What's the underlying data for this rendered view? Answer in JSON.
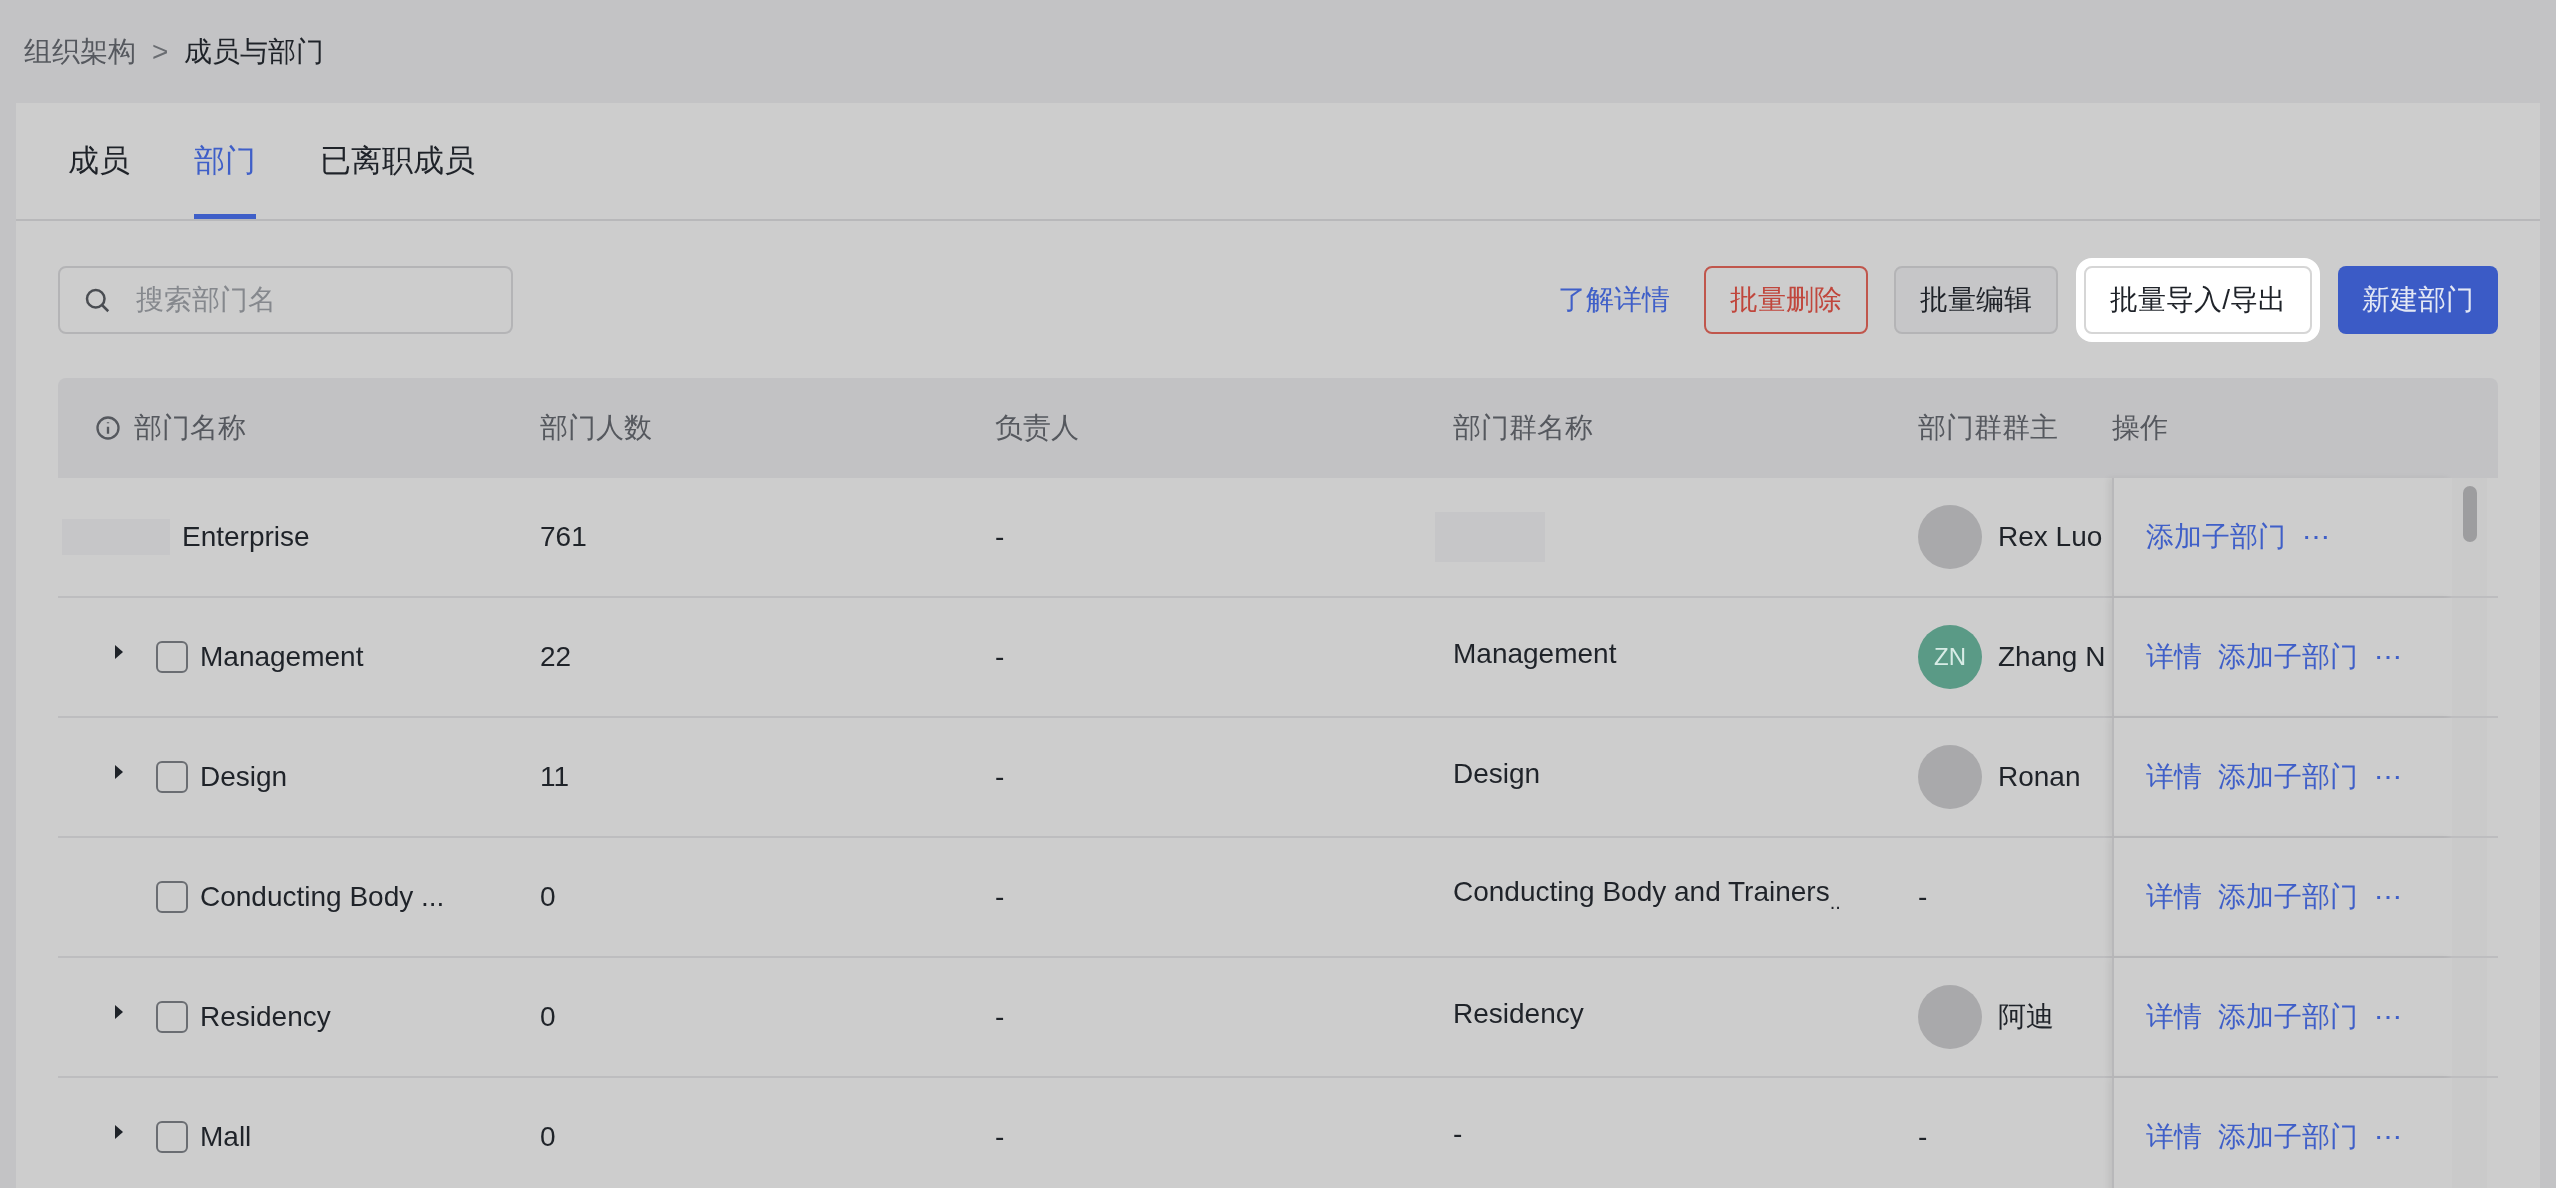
{
  "breadcrumb": {
    "parent": "组织架构",
    "separator": ">",
    "current": "成员与部门"
  },
  "tabs": [
    {
      "label": "成员",
      "selected": false
    },
    {
      "label": "部门",
      "selected": true
    },
    {
      "label": "已离职成员",
      "selected": false
    }
  ],
  "search": {
    "placeholder": "搜索部门名"
  },
  "actions": [
    {
      "kind": "link",
      "label": "了解详情"
    },
    {
      "kind": "danger",
      "label": "批量删除"
    },
    {
      "kind": "default",
      "label": "批量编辑"
    },
    {
      "kind": "highlighted",
      "label": "批量导入/导出"
    },
    {
      "kind": "primary",
      "label": "新建部门"
    }
  ],
  "table": {
    "columns": [
      "部门名称",
      "部门人数",
      "负责人",
      "部门群名称",
      "部门群群主",
      "操作"
    ],
    "rows": [
      {
        "kind": "root",
        "name": "Enterprise",
        "count": "761",
        "leader": "-",
        "owner": {
          "kind": "photo",
          "name": "Rex Luo"
        },
        "actions": [
          "添加子部门",
          "⋯"
        ]
      },
      {
        "kind": "department",
        "expandable": true,
        "checked": false,
        "name": "Management",
        "count": "22",
        "leader": "-",
        "group_name": "Management",
        "owner": {
          "kind": "initials",
          "initials": "ZN",
          "color": "#5a9a86",
          "name": "Zhang N"
        },
        "actions": [
          "详情",
          "添加子部门",
          "⋯"
        ]
      },
      {
        "kind": "department",
        "expandable": true,
        "checked": false,
        "name": "Design",
        "count": "11",
        "leader": "-",
        "group_name": "Design",
        "owner": {
          "kind": "photo",
          "name": "Ronan"
        },
        "actions": [
          "详情",
          "添加子部门",
          "⋯"
        ]
      },
      {
        "kind": "department",
        "expandable": false,
        "checked": false,
        "name": "Conducting Body ...",
        "count": "0",
        "leader": "-",
        "group_name": "Conducting Body and Trainers",
        "group_name_mark": "..",
        "owner": {
          "kind": "none",
          "name": "-"
        },
        "actions": [
          "详情",
          "添加子部门",
          "⋯"
        ]
      },
      {
        "kind": "department",
        "expandable": true,
        "checked": false,
        "name": "Residency",
        "count": "0",
        "leader": "-",
        "group_name": "Residency",
        "owner": {
          "kind": "photo",
          "name": "阿迪"
        },
        "actions": [
          "详情",
          "添加子部门",
          "⋯"
        ]
      },
      {
        "kind": "department",
        "expandable": true,
        "checked": false,
        "name": "Mall",
        "count": "0",
        "leader": "-",
        "group_name": "-",
        "owner": {
          "kind": "none",
          "name": "-"
        },
        "actions": [
          "详情",
          "添加子部门",
          "⋯"
        ]
      }
    ]
  }
}
